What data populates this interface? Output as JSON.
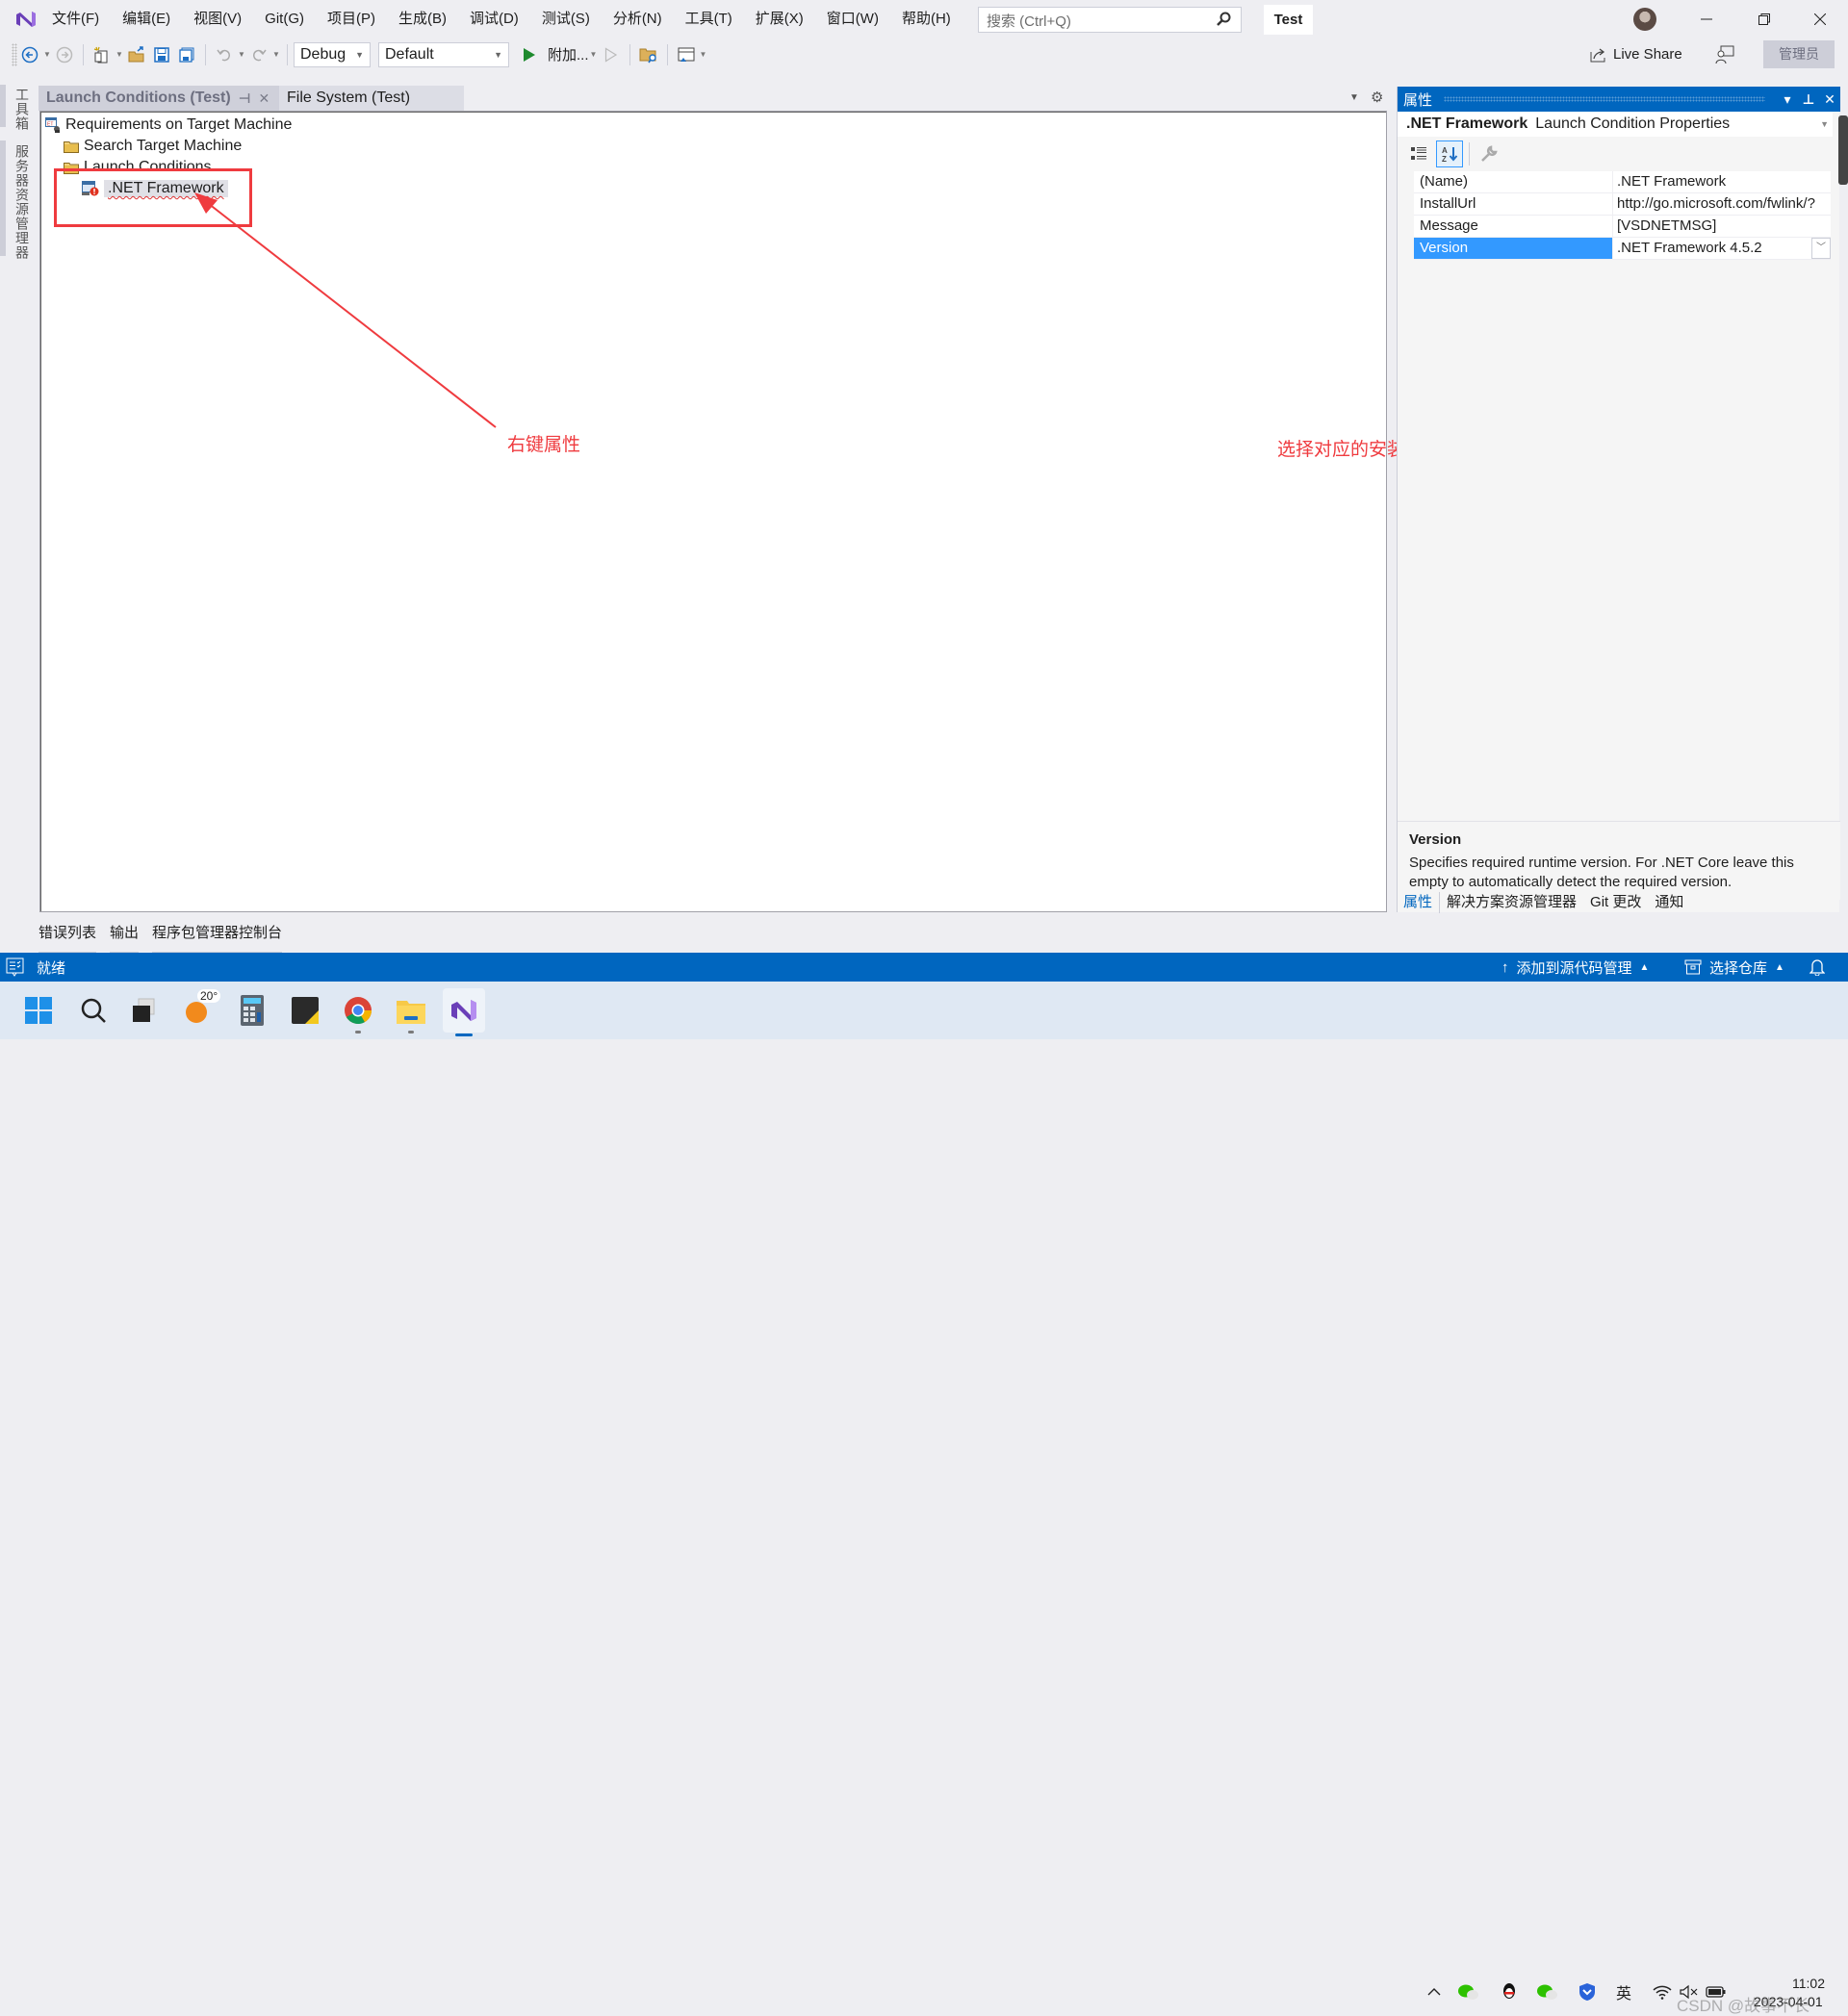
{
  "menubar": {
    "items": [
      "文件(F)",
      "编辑(E)",
      "视图(V)",
      "Git(G)",
      "项目(P)",
      "生成(B)",
      "调试(D)",
      "测试(S)",
      "分析(N)",
      "工具(T)",
      "扩展(X)",
      "窗口(W)",
      "帮助(H)"
    ],
    "search_placeholder": "搜索 (Ctrl+Q)",
    "solution_name": "Test"
  },
  "toolbar": {
    "configuration": "Debug",
    "platform": "Default",
    "attach_label": "附加...",
    "live_share_label": "Live Share",
    "admin_label": "管理员"
  },
  "left_strip": {
    "tabs": [
      "工具箱",
      "服务器资源管理器"
    ]
  },
  "document_tabs": [
    {
      "label": "Launch Conditions (Test)",
      "active": true
    },
    {
      "label": "File System (Test)",
      "active": false
    }
  ],
  "designer": {
    "tree": [
      {
        "label": "Requirements on Target Machine",
        "level": 0,
        "icon": "requirements-icon"
      },
      {
        "label": "Search Target Machine",
        "level": 1,
        "icon": "folder-icon"
      },
      {
        "label": "Launch Conditions",
        "level": 1,
        "icon": "folder-icon"
      },
      {
        "label": ".NET Framework",
        "level": 2,
        "icon": "launch-condition-warning-icon",
        "selected": true
      }
    ]
  },
  "annotations": {
    "left_note": "右键属性",
    "right_note": "选择对应的安装框架",
    "color": "#ef3b3f"
  },
  "properties": {
    "panel_title": "属性",
    "object_name": ".NET Framework",
    "object_type": "Launch Condition Properties",
    "rows": [
      {
        "name": "(Name)",
        "value": ".NET Framework"
      },
      {
        "name": "InstallUrl",
        "value": "http://go.microsoft.com/fwlink/?"
      },
      {
        "name": "Message",
        "value": "[VSDNETMSG]"
      },
      {
        "name": "Version",
        "value": ".NET Framework 4.5.2",
        "selected": true
      }
    ],
    "description_title": "Version",
    "description_body": "Specifies required runtime version.  For .NET Core leave this empty to automatically detect the required version.",
    "bottom_tabs": [
      "属性",
      "解决方案资源管理器",
      "Git 更改",
      "通知"
    ]
  },
  "bottom_tool_tabs": [
    "错误列表",
    "输出",
    "程序包管理器控制台"
  ],
  "statusbar": {
    "status": "就绪",
    "source_control": "添加到源代码管理",
    "repository": "选择仓库",
    "accent": "#0066bf"
  },
  "taskbar": {
    "weather_temp": "20°",
    "tray_ime": "英",
    "clock_time": "11:02",
    "clock_date": "2023-04-01",
    "watermark": "CSDN @故事不长"
  }
}
